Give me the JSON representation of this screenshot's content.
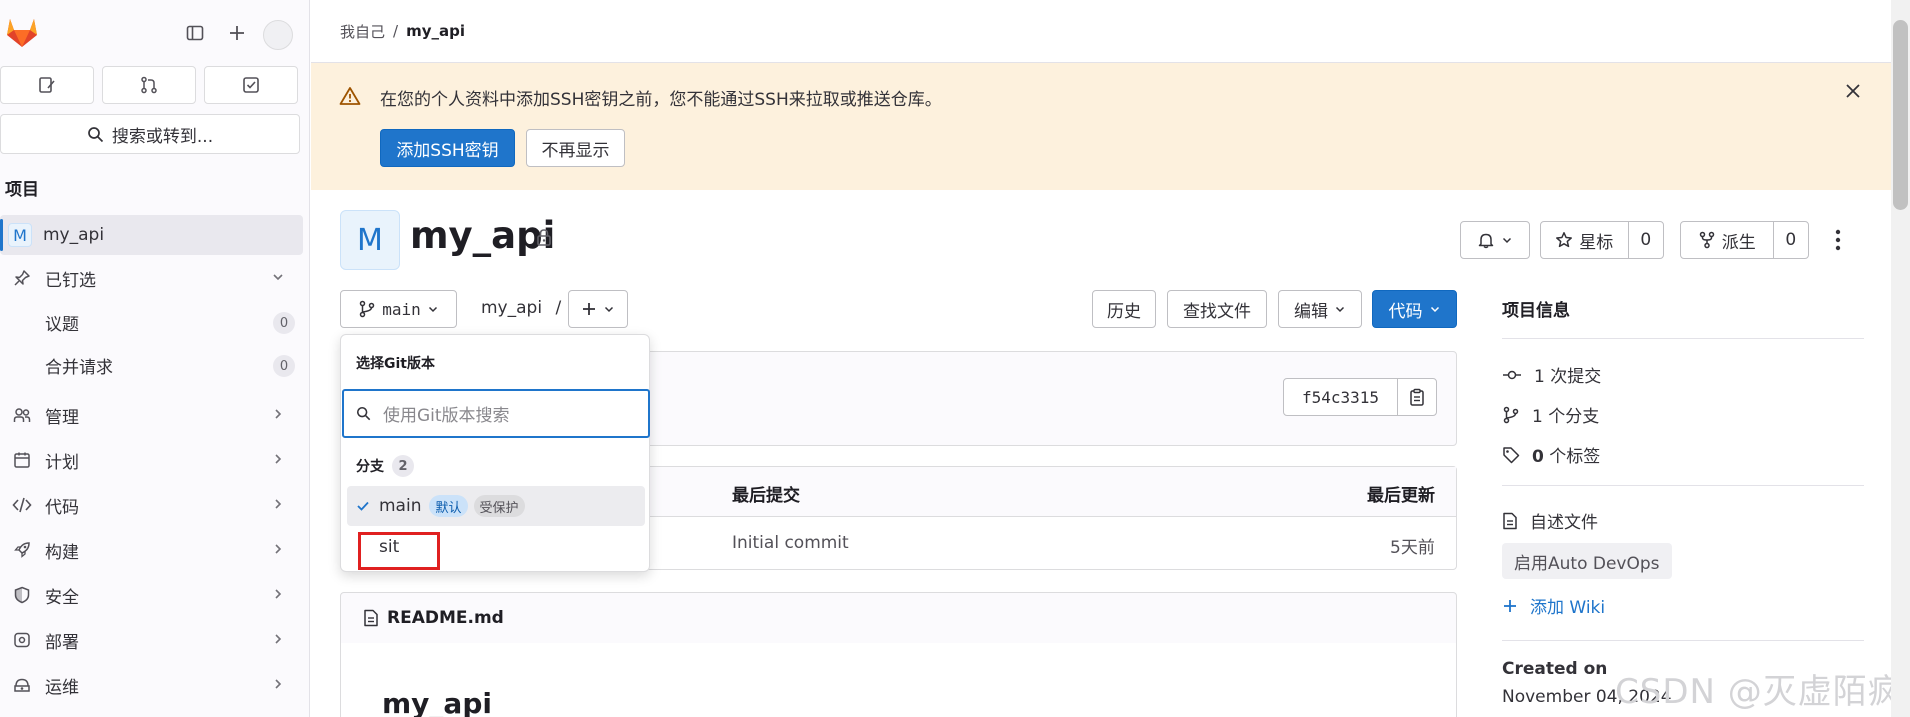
{
  "breadcrumb": {
    "parent": "我自己",
    "separator": "/",
    "current": "my_api"
  },
  "sidebar": {
    "search_label": "搜索或转到...",
    "section_title": "项目",
    "project_badge": "M",
    "project_name": "my_api",
    "pinned_label": "已钉选",
    "pinned_items": [
      {
        "label": "议题",
        "count": "0"
      },
      {
        "label": "合并请求",
        "count": "0"
      }
    ],
    "nav_items": [
      {
        "label": "管理",
        "icon": "users-icon"
      },
      {
        "label": "计划",
        "icon": "calendar-icon"
      },
      {
        "label": "代码",
        "icon": "code-icon"
      },
      {
        "label": "构建",
        "icon": "rocket-icon"
      },
      {
        "label": "安全",
        "icon": "shield-icon"
      },
      {
        "label": "部署",
        "icon": "deploy-icon"
      },
      {
        "label": "运维",
        "icon": "monitor-icon"
      }
    ]
  },
  "alert": {
    "message": "在您的个人资料中添加SSH密钥之前，您不能通过SSH来拉取或推送仓库。",
    "add_button": "添加SSH密钥",
    "dismiss_button": "不再显示"
  },
  "project": {
    "avatar_letter": "M",
    "title": "my_api",
    "star_label": "星标",
    "star_count": "0",
    "fork_label": "派生",
    "fork_count": "0"
  },
  "toolbar": {
    "branch": "main",
    "path": "my_api",
    "path_sep": "/",
    "history": "历史",
    "find_file": "查找文件",
    "edit": "编辑",
    "code": "代码"
  },
  "commit": {
    "sha": "f54c3315"
  },
  "table": {
    "col_last_commit": "最后提交",
    "col_last_update": "最后更新",
    "row_commit": "Initial commit",
    "row_update": "5天前"
  },
  "readme": {
    "filename": "README.md",
    "heading": "my_api"
  },
  "dropdown": {
    "title": "选择Git版本",
    "search_placeholder": "使用Git版本搜索",
    "section_label": "分支",
    "section_count": "2",
    "branches": [
      {
        "name": "main",
        "default_badge": "默认",
        "protected_badge": "受保护"
      },
      {
        "name": "sit"
      }
    ]
  },
  "info": {
    "title": "项目信息",
    "commits": "1 次提交",
    "branches": "1 个分支",
    "tags_count": "0",
    "tags_label": " 个标签",
    "license": "自述文件",
    "autodevops": "启用Auto DevOps",
    "add_wiki": "添加 Wiki",
    "created_label": "Created on",
    "created_date": "November 04, 2024"
  },
  "watermark": "CSDN @灭虚陌疯",
  "colors": {
    "accent": "#1f75cb",
    "alert_bg": "#fdf1dd",
    "highlight": "#e02020"
  }
}
